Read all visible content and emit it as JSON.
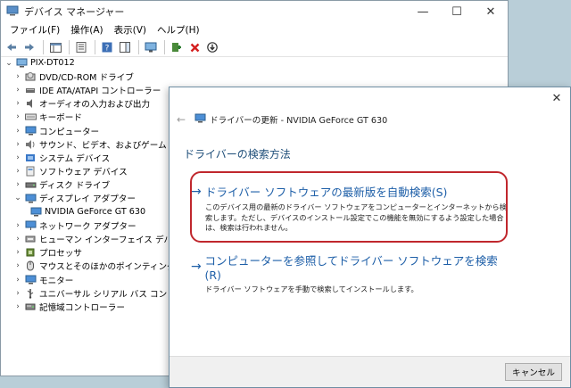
{
  "device_manager": {
    "title": "デバイス マネージャー",
    "window_controls": {
      "minimize": "—",
      "maximize": "☐",
      "close": "✕"
    },
    "menu": [
      "ファイル(F)",
      "操作(A)",
      "表示(V)",
      "ヘルプ(H)"
    ],
    "tree": [
      {
        "label": "PIX-DT012",
        "icon": "computer-root-icon",
        "level": 0,
        "expanded": true
      },
      {
        "label": "DVD/CD-ROM ドライブ",
        "icon": "dvd-drive-icon",
        "level": 1
      },
      {
        "label": "IDE ATA/ATAPI コントローラー",
        "icon": "ide-controller-icon",
        "level": 1
      },
      {
        "label": "オーディオの入力および出力",
        "icon": "speaker-icon",
        "level": 1
      },
      {
        "label": "キーボード",
        "icon": "keyboard-icon",
        "level": 1
      },
      {
        "label": "コンピューター",
        "icon": "monitor-icon",
        "level": 1
      },
      {
        "label": "サウンド、ビデオ、およびゲーム コントローラー",
        "icon": "sound-icon",
        "level": 1
      },
      {
        "label": "システム デバイス",
        "icon": "system-device-icon",
        "level": 1
      },
      {
        "label": "ソフトウェア デバイス",
        "icon": "software-device-icon",
        "level": 1
      },
      {
        "label": "ディスク ドライブ",
        "icon": "disk-drive-icon",
        "level": 1
      },
      {
        "label": "ディスプレイ アダプター",
        "icon": "display-adapter-icon",
        "level": 1,
        "expanded": true
      },
      {
        "label": "NVIDIA GeForce GT 630",
        "icon": "display-adapter-icon",
        "level": 2
      },
      {
        "label": "ネットワーク アダプター",
        "icon": "network-adapter-icon",
        "level": 1
      },
      {
        "label": "ヒューマン インターフェイス デバイス",
        "icon": "hid-icon",
        "level": 1
      },
      {
        "label": "プロセッサ",
        "icon": "processor-icon",
        "level": 1
      },
      {
        "label": "マウスとそのほかのポインティング デバイス",
        "icon": "mouse-icon",
        "level": 1
      },
      {
        "label": "モニター",
        "icon": "monitor-icon",
        "level": 1
      },
      {
        "label": "ユニバーサル シリアル バス コントローラー",
        "icon": "usb-icon",
        "level": 1
      },
      {
        "label": "記憶域コントローラー",
        "icon": "storage-controller-icon",
        "level": 1
      }
    ]
  },
  "dialog": {
    "header": "ドライバーの更新 - NVIDIA GeForce GT 630",
    "heading": "ドライバーの検索方法",
    "option_auto": {
      "arrow": "→",
      "title": "ドライバー ソフトウェアの最新版を自動検索(S)",
      "description": "このデバイス用の最新のドライバー ソフトウェアをコンピューターとインターネットから検索します。ただし、デバイスのインストール設定でこの機能を無効にするよう設定した場合は、検索は行われません。"
    },
    "option_browse": {
      "arrow": "→",
      "title": "コンピューターを参照してドライバー ソフトウェアを検索(R)",
      "description": "ドライバー ソフトウェアを手動で検索してインストールします。"
    },
    "cancel_label": "キャンセル",
    "close": "✕",
    "back": "←"
  },
  "colors": {
    "link": "#1e5fa8",
    "heading": "#1e4e79",
    "highlight_ring": "#c0272d",
    "desktop": "#b9ced8"
  }
}
